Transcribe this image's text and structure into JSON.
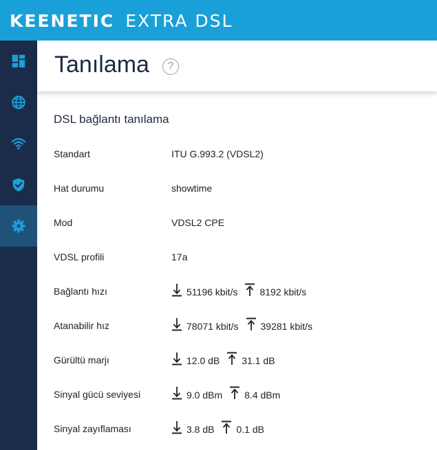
{
  "brand": {
    "name": "KEENETIC",
    "model": "EXTRA DSL"
  },
  "sidebar": {
    "items": [
      {
        "icon": "dashboard-icon",
        "active": false
      },
      {
        "icon": "globe-icon",
        "active": false
      },
      {
        "icon": "wifi-icon",
        "active": false
      },
      {
        "icon": "shield-icon",
        "active": false
      },
      {
        "icon": "gear-icon",
        "active": true
      }
    ]
  },
  "page": {
    "title": "Tanılama",
    "help": "?"
  },
  "section": {
    "title": "DSL bağlantı tanılama"
  },
  "rows": {
    "standard": {
      "label": "Standart",
      "value": "ITU G.993.2 (VDSL2)"
    },
    "line_state": {
      "label": "Hat durumu",
      "value": "showtime"
    },
    "mode": {
      "label": "Mod",
      "value": "VDSL2 CPE"
    },
    "profile": {
      "label": "VDSL profili",
      "value": "17a"
    },
    "link_rate": {
      "label": "Bağlantı hızı",
      "down": "51196 kbit/s",
      "up": "8192 kbit/s"
    },
    "attainable": {
      "label": "Atanabilir hız",
      "down": "78071 kbit/s",
      "up": "39281 kbit/s"
    },
    "snr_margin": {
      "label": "Gürültü marjı",
      "down": "12.0 dB",
      "up": "31.1 dB"
    },
    "signal_power": {
      "label": "Sinyal gücü seviyesi",
      "down": "9.0 dBm",
      "up": "8.4 dBm"
    },
    "attenuation": {
      "label": "Sinyal zayıflaması",
      "down": "3.8 dB",
      "up": "0.1 dB"
    }
  },
  "colors": {
    "topbar": "#1aa0d8",
    "sidebar": "#1a2c49",
    "sidebar_active": "#1f5279",
    "icon": "#1aa0d8"
  }
}
